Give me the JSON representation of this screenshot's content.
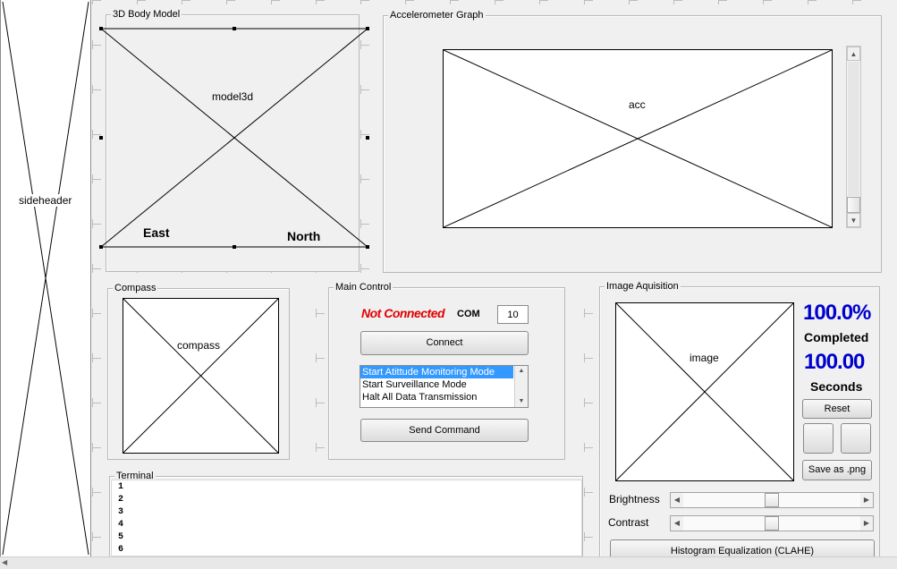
{
  "sideheader": {
    "label": "sideheader"
  },
  "model_panel": {
    "title": "3D Body Model",
    "placeholder": "model3d",
    "east_label": "East",
    "north_label": "North"
  },
  "acc_panel": {
    "title": "Accelerometer Graph",
    "placeholder": "acc"
  },
  "compass_panel": {
    "title": "Compass",
    "placeholder": "compass"
  },
  "main_control": {
    "title": "Main Control",
    "status": "Not Connected",
    "com_label": "COM",
    "com_value": "10",
    "connect_label": "Connect",
    "modes": [
      "Start Atittude Monitoring Mode",
      "Start Surveillance Mode",
      "Halt All Data Transmission"
    ],
    "send_label": "Send Command"
  },
  "terminal": {
    "title": "Terminal",
    "lines": [
      "1",
      "2",
      "3",
      "4",
      "5",
      "6"
    ]
  },
  "image_panel": {
    "title": "Image Aquisition",
    "placeholder": "image",
    "percent": "100.0%",
    "completed_label": "Completed",
    "seconds_value": "100.00",
    "seconds_label": "Seconds",
    "reset_label": "Reset",
    "save_label": "Save as .png",
    "brightness_label": "Brightness",
    "contrast_label": "Contrast",
    "brightness_level": 0.5,
    "contrast_level": 0.5,
    "clahe_label": "Histogram Equalization (CLAHE)"
  },
  "colors": {
    "status_red": "#e00000",
    "value_blue": "#0000cc",
    "selection_blue": "#3399ff"
  }
}
